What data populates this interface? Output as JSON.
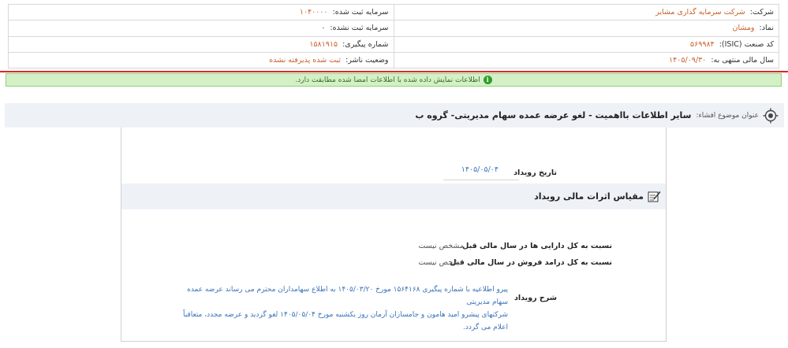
{
  "company_info": {
    "company_label": "شرکت:",
    "company_value": "شرکت سرمایه گذاری مشایر",
    "registered_capital_label": "سرمایه ثبت شده:",
    "registered_capital_value": "۱۰۴۰۰۰۰",
    "symbol_label": "نماد:",
    "symbol_value": "ومشان",
    "unregistered_capital_label": "سرمایه ثبت نشده:",
    "unregistered_capital_value": "۰",
    "isic_label": "کد صنعت (ISIC):",
    "isic_value": "۵۶۹۹۸۴",
    "tracking_label": "شماره پیگیری:",
    "tracking_value": "۱۵۸۱۹۱۵",
    "fiscal_year_label": "سال مالی منتهی به:",
    "fiscal_year_value": "۱۴۰۵/۰۹/۳۰",
    "publisher_status_label": "وضعیت ناشر:",
    "publisher_status_value": "ثبت شده پذیرفته نشده"
  },
  "notice": {
    "text": "اطلاعات نمایش داده شده با اطلاعات امضا شده مطابقت دارد.",
    "icon": "info-icon",
    "accent": "#2e9e2b"
  },
  "subject": {
    "label": "عنوان موضوع افشاء:",
    "value": "سایر اطلاعات بااهمیت - لغو عرضه عمده سهام مدیریتی- گروه ب",
    "icon": "target-icon"
  },
  "event": {
    "date_label": "تاریخ رویداد",
    "date_value": "۱۴۰۵/۰۵/۰۴",
    "section_title": "مقیاس اثرات مالی رویداد",
    "section_icon": "edit-note-icon",
    "assets_ratio_label": "نسبت به کل دارایی ها در سال مالی قبل",
    "assets_ratio_value": "مشخص نیست",
    "revenue_ratio_label": "نسبت به کل درامد فروش در سال مالی قبل",
    "revenue_ratio_value": "مشخص نیست",
    "description_label": "شرح رویداد",
    "description_line1": "پیرو اطلاعیه با شماره پیگیری ۱۵۶۴۱۶۸ مورخ ۱۴۰۵/۰۳/۲۰ به اطلاع سهامداران محترم می رساند عرضه عمده سهام مدیریتی",
    "description_line2": "شرکتهای پیشرو امید هامون و جامسازان آرمان روز یکشنبه مورخ ۱۴۰۵/۰۵/۰۴ لغو گردید و عرضه مجدد، متعاقباً اعلام می گردد."
  },
  "colors": {
    "value_orange": "#c8612d",
    "link_blue": "#3b73b9",
    "alert_red": "#e42525",
    "header_bg": "#eef2f7"
  }
}
